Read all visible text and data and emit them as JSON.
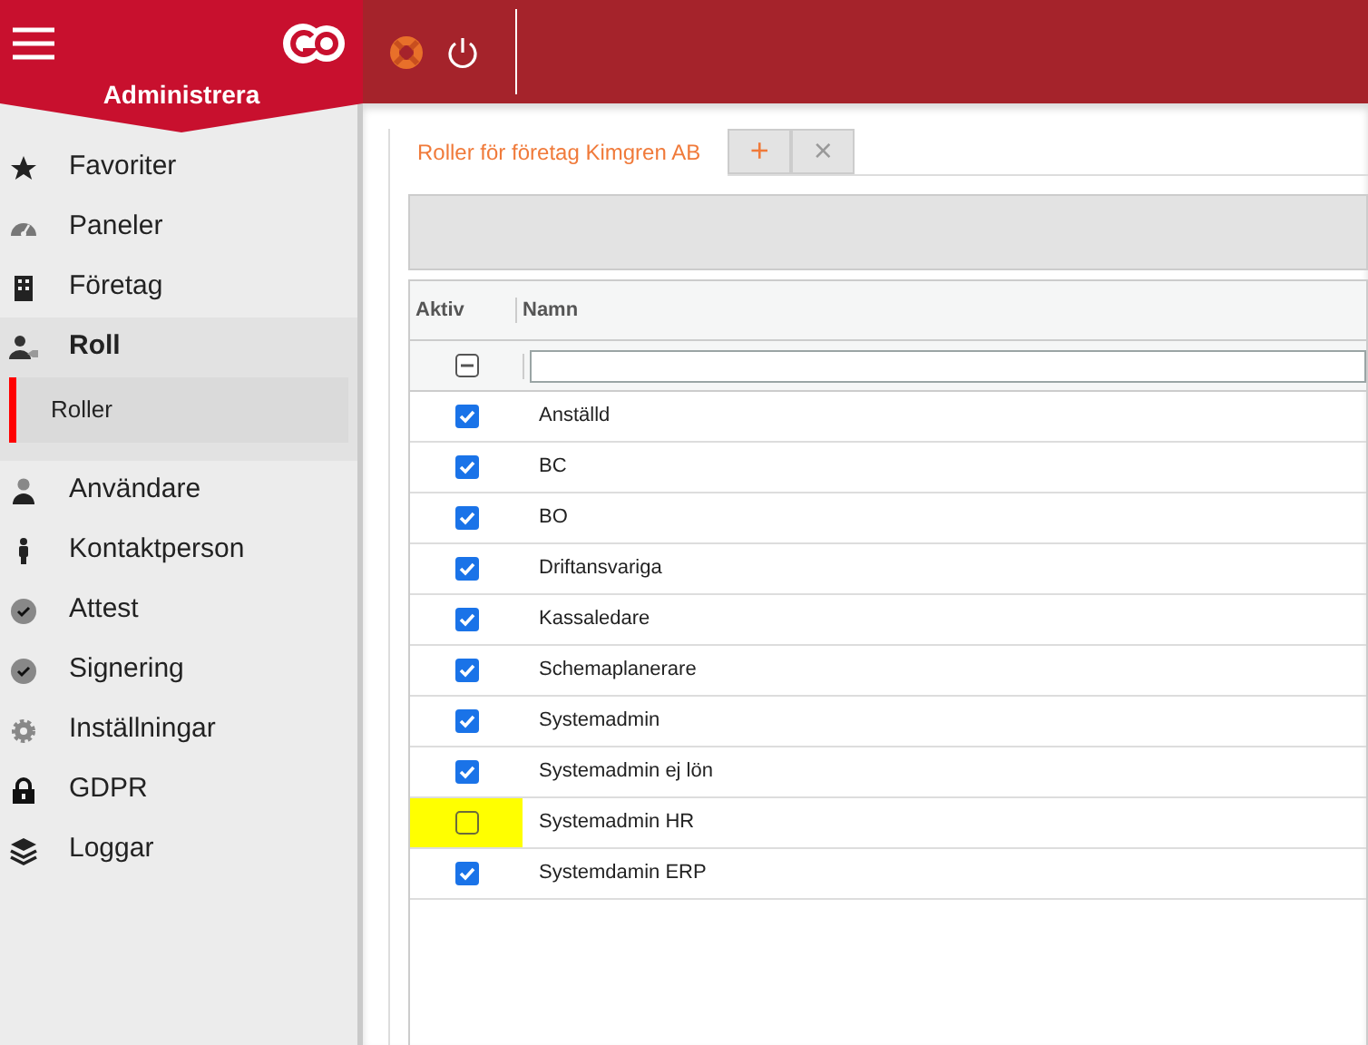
{
  "header": {
    "title": "Administrera"
  },
  "sidebar": {
    "items": [
      {
        "label": "Favoriter",
        "kind": "star",
        "selected": false
      },
      {
        "label": "Paneler",
        "kind": "gauge",
        "selected": false
      },
      {
        "label": "Företag",
        "kind": "building",
        "selected": false
      },
      {
        "label": "Roll",
        "kind": "usertag",
        "selected": true,
        "expanded": true,
        "children": [
          {
            "label": "Roller",
            "selected": true
          }
        ]
      },
      {
        "label": "Användare",
        "kind": "user",
        "selected": false
      },
      {
        "label": "Kontaktperson",
        "kind": "person",
        "selected": false
      },
      {
        "label": "Attest",
        "kind": "check",
        "selected": false
      },
      {
        "label": "Signering",
        "kind": "check",
        "selected": false
      },
      {
        "label": "Inställningar",
        "kind": "gear",
        "selected": false
      },
      {
        "label": "GDPR",
        "kind": "lock",
        "selected": false
      },
      {
        "label": "Loggar",
        "kind": "layers",
        "selected": false
      }
    ]
  },
  "tabs": [
    {
      "label": "Roller för företag Kimgren AB",
      "selected": true
    }
  ],
  "tab_actions": [
    "+",
    "×"
  ],
  "table": {
    "columns": [
      "Aktiv",
      "Namn"
    ],
    "select_all": {
      "checked": false,
      "indeterminate": true
    },
    "rows": [
      {
        "name": "Anställd",
        "checked": true,
        "highlighted": false
      },
      {
        "name": "BC",
        "checked": true,
        "highlighted": false
      },
      {
        "name": "BO",
        "checked": true,
        "highlighted": false
      },
      {
        "name": "Driftansvariga",
        "checked": true,
        "highlighted": false
      },
      {
        "name": "Kassaledare",
        "checked": true,
        "highlighted": false
      },
      {
        "name": "Schemaplanerare",
        "checked": true,
        "highlighted": false
      },
      {
        "name": "Systemadmin",
        "checked": true,
        "highlighted": false
      },
      {
        "name": "Systemadmin ej lön",
        "checked": true,
        "highlighted": false
      },
      {
        "name": "Systemadmin HR",
        "checked": false,
        "highlighted": true
      },
      {
        "name": "Systemdamin ERP",
        "checked": true,
        "highlighted": false
      }
    ]
  }
}
